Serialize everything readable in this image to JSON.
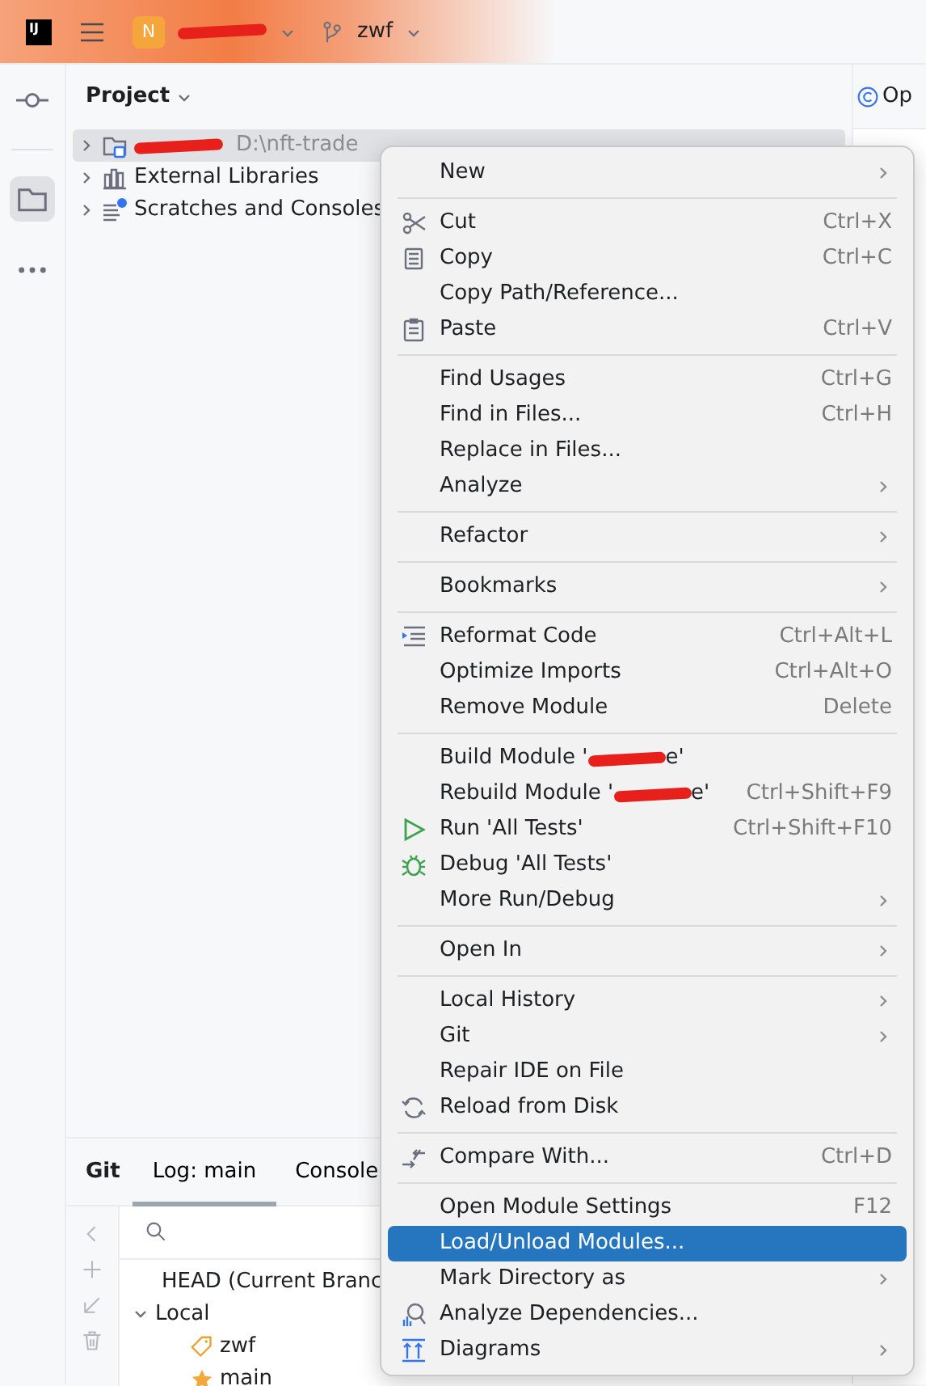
{
  "toolbar": {
    "logo_text": "IJ",
    "project": {
      "badge": "N",
      "redacted": true
    },
    "branch": "zwf"
  },
  "left_strip": [
    {
      "kind": "commit",
      "selected": false
    },
    {
      "kind": "folder",
      "selected": true
    },
    {
      "kind": "more",
      "selected": false
    }
  ],
  "project_panel": {
    "title": "Project",
    "tree": [
      {
        "kind": "module",
        "redacted": true,
        "hint": "D:\\nft-trade",
        "selected": true,
        "expanded": false
      },
      {
        "kind": "libraries",
        "label": "External Libraries",
        "selected": false,
        "expanded": false
      },
      {
        "kind": "scratches",
        "label": "Scratches and Consoles",
        "selected": false,
        "expanded": false
      }
    ]
  },
  "editor_tab": {
    "label": "Op"
  },
  "context_menu": [
    {
      "kind": "item",
      "label": "New",
      "submenu": true,
      "selected": false
    },
    {
      "kind": "separator"
    },
    {
      "kind": "scissors",
      "label": "Cut",
      "shortcut": "Ctrl+X",
      "selected": false
    },
    {
      "kind": "copy",
      "label": "Copy",
      "shortcut": "Ctrl+C",
      "selected": false
    },
    {
      "kind": "item",
      "label": "Copy Path/Reference...",
      "selected": false
    },
    {
      "kind": "paste",
      "label": "Paste",
      "shortcut": "Ctrl+V",
      "selected": false
    },
    {
      "kind": "separator"
    },
    {
      "kind": "item",
      "label": "Find Usages",
      "shortcut": "Ctrl+G",
      "selected": false
    },
    {
      "kind": "item",
      "label": "Find in Files...",
      "shortcut": "Ctrl+H",
      "selected": false
    },
    {
      "kind": "item",
      "label": "Replace in Files...",
      "selected": false
    },
    {
      "kind": "item",
      "label": "Analyze",
      "submenu": true,
      "selected": false
    },
    {
      "kind": "separator"
    },
    {
      "kind": "item",
      "label": "Refactor",
      "submenu": true,
      "selected": false
    },
    {
      "kind": "separator"
    },
    {
      "kind": "item",
      "label": "Bookmarks",
      "submenu": true,
      "selected": false
    },
    {
      "kind": "separator"
    },
    {
      "kind": "reformat",
      "label": "Reformat Code",
      "shortcut": "Ctrl+Alt+L",
      "selected": false
    },
    {
      "kind": "item",
      "label": "Optimize Imports",
      "shortcut": "Ctrl+Alt+O",
      "selected": false
    },
    {
      "kind": "item",
      "label": "Remove Module",
      "shortcut": "Delete",
      "selected": false
    },
    {
      "kind": "separator"
    },
    {
      "kind": "item",
      "label": "Build Module '",
      "redacted": true,
      "label_after": "e'",
      "selected": false
    },
    {
      "kind": "item",
      "label": "Rebuild Module '",
      "redacted": true,
      "label_after": "e'",
      "shortcut": "Ctrl+Shift+F9",
      "selected": false
    },
    {
      "kind": "run",
      "label": "Run 'All Tests'",
      "shortcut": "Ctrl+Shift+F10",
      "selected": false
    },
    {
      "kind": "debug",
      "label": "Debug 'All Tests'",
      "selected": false
    },
    {
      "kind": "item",
      "label": "More Run/Debug",
      "submenu": true,
      "selected": false
    },
    {
      "kind": "separator"
    },
    {
      "kind": "item",
      "label": "Open In",
      "submenu": true,
      "selected": false
    },
    {
      "kind": "separator"
    },
    {
      "kind": "item",
      "label": "Local History",
      "submenu": true,
      "selected": false
    },
    {
      "kind": "item",
      "label": "Git",
      "submenu": true,
      "selected": false
    },
    {
      "kind": "item",
      "label": "Repair IDE on File",
      "selected": false
    },
    {
      "kind": "reload",
      "label": "Reload from Disk",
      "selected": false
    },
    {
      "kind": "separator"
    },
    {
      "kind": "compare",
      "label": "Compare With...",
      "shortcut": "Ctrl+D",
      "selected": false
    },
    {
      "kind": "separator"
    },
    {
      "kind": "item",
      "label": "Open Module Settings",
      "shortcut": "F12",
      "selected": false
    },
    {
      "kind": "item",
      "label": "Load/Unload Modules...",
      "selected": true
    },
    {
      "kind": "item",
      "label": "Mark Directory as",
      "submenu": true,
      "selected": false
    },
    {
      "kind": "dependencies",
      "label": "Analyze Dependencies...",
      "selected": false
    },
    {
      "kind": "diagrams",
      "label": "Diagrams",
      "submenu": true,
      "selected": false
    }
  ],
  "git_panel": {
    "title": "Git",
    "tabs": [
      {
        "label": "Log: main",
        "selected": true
      },
      {
        "label": "Console",
        "selected": false
      }
    ],
    "tools": [
      {
        "kind": "back"
      },
      {
        "kind": "add"
      },
      {
        "kind": "checkout"
      },
      {
        "kind": "delete"
      }
    ],
    "tree": [
      {
        "label": "HEAD (Current Branc"
      },
      {
        "label": "Local",
        "expanded": true,
        "children": [
          {
            "label": "zwf",
            "kind": "tag"
          },
          {
            "label": "main",
            "kind": "star"
          }
        ]
      }
    ]
  }
}
